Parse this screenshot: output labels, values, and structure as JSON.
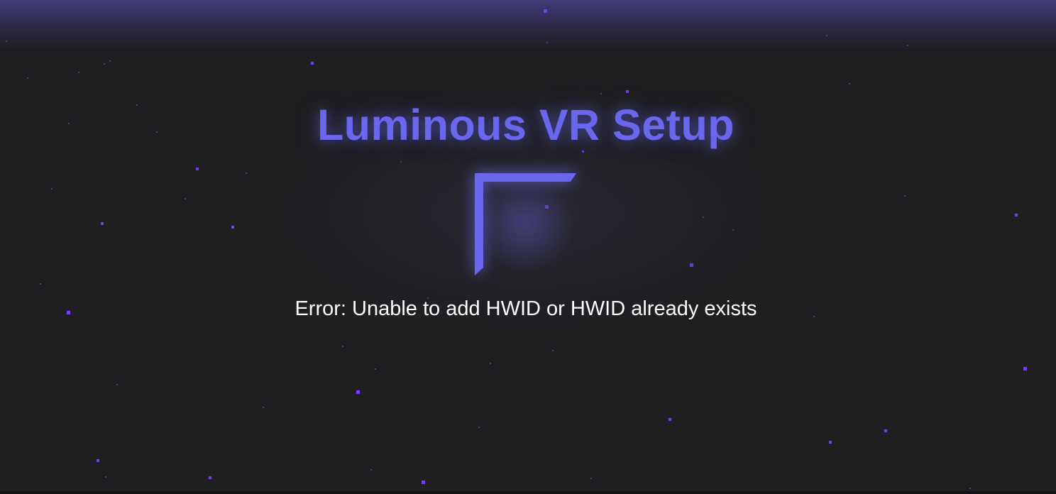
{
  "app": {
    "title": "Luminous VR Setup",
    "logo_icon": "corner-bracket-logo-icon",
    "error_message": "Error: Unable to add HWID or HWID already exists"
  },
  "colors": {
    "background": "#1f1f21",
    "accent": "#6a66ee",
    "top_glow": "#453f7e",
    "star": "#7a3cf2",
    "text": "#ffffff"
  }
}
